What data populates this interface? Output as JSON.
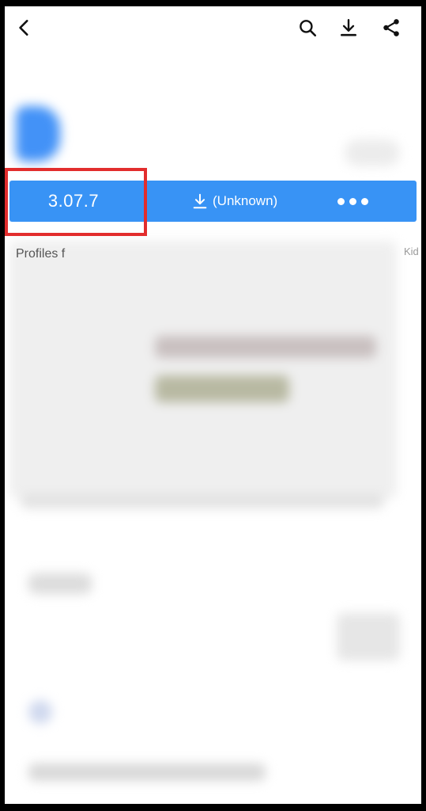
{
  "topbar": {
    "back_icon": "back-arrow-icon",
    "search_icon": "search-icon",
    "download_icon": "download-icon",
    "share_icon": "share-icon"
  },
  "action_bar": {
    "version": "3.07.7",
    "download_label": "(Unknown)",
    "more_icon": "more-dots-icon"
  },
  "screenshots": {
    "caption": "Profiles f",
    "side_caption": "Kid"
  },
  "colors": {
    "accent": "#3893f5",
    "highlight_frame": "#e22d2d"
  }
}
